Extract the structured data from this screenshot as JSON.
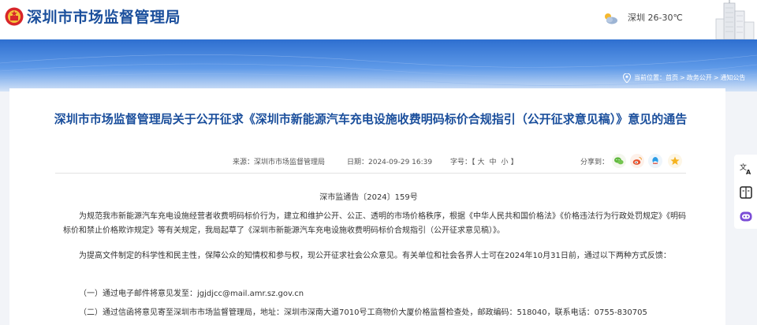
{
  "header": {
    "site_title": "深圳市市场监督管理局",
    "weather": {
      "icon": "partly-cloudy-icon",
      "text": "深圳 26-30℃"
    }
  },
  "breadcrumb": {
    "prefix": "当前位置：",
    "items": [
      "首页",
      "政务公开",
      "通知公告"
    ],
    "separator": ">"
  },
  "article": {
    "title": "深圳市市场监督管理局关于公开征求《深圳市新能源汽车充电设施收费明码标价合规指引（公开征求意见稿）》意见的通告",
    "meta": {
      "source": "来源：深圳市市场监督管理局",
      "date": "日期：2024-09-29 16:39",
      "font_size_label": "字号：【",
      "font_sizes": [
        "大",
        "中",
        "小"
      ],
      "font_size_close": "】"
    },
    "share_label": "分享到：",
    "share_targets": [
      "wechat",
      "weibo",
      "qq",
      "qzone"
    ],
    "doc_number": "深市监通告〔2024〕159号",
    "paragraphs": [
      "为规范我市新能源汽车充电设施经营者收费明码标价行为，建立和维护公开、公正、透明的市场价格秩序，根据《中华人民共和国价格法》《价格违法行为行政处罚规定》《明码标价和禁止价格欺诈规定》等有关规定，我局起草了《深圳市新能源汽车充电设施收费明码标价合规指引（公开征求意见稿）》。",
      "为提高文件制定的科学性和民主性，保障公众的知情权和参与权，现公开征求社会公众意见。有关单位和社会各界人士可在2024年10月31日前，通过以下两种方式反馈：",
      "（一）通过电子邮件将意见发至：jgjdjcc@mail.amr.sz.gov.cn",
      "（二）通过信函将意见寄至深圳市市场监督管理局，地址：深圳市深南大道7010号工商物价大厦价格监督检查处，邮政编码：518040，联系电话：0755-830705"
    ]
  },
  "tools": [
    "translate-icon",
    "reader-icon",
    "assistant-robot-icon"
  ],
  "colors": {
    "brand_blue": "#1b4f9c",
    "band_blue": "#2e6fd0"
  }
}
